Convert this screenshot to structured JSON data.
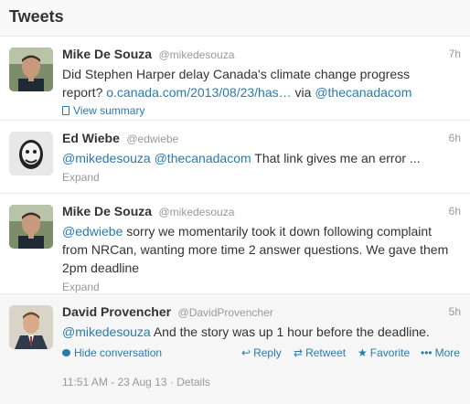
{
  "header": {
    "title": "Tweets"
  },
  "tweets": [
    {
      "fullname": "Mike De Souza",
      "username": "@mikedesouza",
      "time": "7h",
      "text_1": "Did Stephen Harper delay Canada's climate change progress report? ",
      "link_1": "o.canada.com/2013/08/23/has…",
      "text_2": " via ",
      "mention_1": "@thecanadacom",
      "view_summary": "View summary"
    },
    {
      "fullname": "Ed Wiebe",
      "username": "@edwiebe",
      "time": "6h",
      "mention_1": "@mikedesouza",
      "text_1": " ",
      "mention_2": "@thecanadacom",
      "text_2": " That link gives me an error ...",
      "expand": "Expand"
    },
    {
      "fullname": "Mike De Souza",
      "username": "@mikedesouza",
      "time": "6h",
      "mention_1": "@edwiebe",
      "text_1": " sorry we momentarily took it down following complaint from NRCan, wanting more time 2 answer questions. We gave them 2pm deadline",
      "expand": "Expand"
    },
    {
      "fullname": "David Provencher",
      "username": "@DavidProvencher",
      "time": "5h",
      "mention_1": "@mikedesouza",
      "text_1": " And the story was up 1 hour before the deadline.",
      "hide_conversation": "Hide conversation",
      "reply": "Reply",
      "retweet": "Retweet",
      "favorite": "Favorite",
      "more": "More",
      "timestamp": "11:51 AM - 23 Aug 13",
      "separator": " · ",
      "details": "Details"
    }
  ],
  "icons": {
    "reply": "reply-icon",
    "retweet": "retweet-icon",
    "favorite": "star-icon",
    "more": "more-dots-icon",
    "summary": "document-icon",
    "conversation": "speech-bubble-icon"
  },
  "colors": {
    "link": "#2a7ab0",
    "meta": "#999999",
    "text": "#333333",
    "expanded_bg": "#f6f6f6"
  }
}
